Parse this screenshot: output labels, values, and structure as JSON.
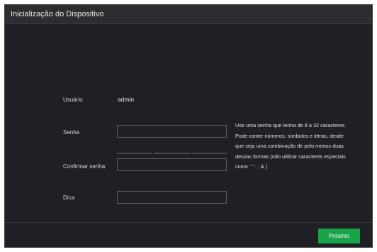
{
  "dialog": {
    "title": "Inicialização do Dispositivo"
  },
  "form": {
    "user": {
      "label": "Usuário",
      "value": "admin"
    },
    "password": {
      "label": "Senha",
      "value": ""
    },
    "confirm": {
      "label": "Confirmar senha",
      "value": ""
    },
    "hint": {
      "label": "Dica",
      "value": ""
    },
    "password_help": "Use uma senha que tenha de 8 a 32 caracteres. Pode conter números, símbolos e letras, desde que seja uma combinação de pelo menos duas dessas formas (não utilizar caracteres especiais como ' \" : ; & )"
  },
  "footer": {
    "next_label": "Próximo"
  },
  "colors": {
    "accent": "#1aa44a",
    "panel": "#1f2023",
    "titlebar": "#2b2d31"
  }
}
